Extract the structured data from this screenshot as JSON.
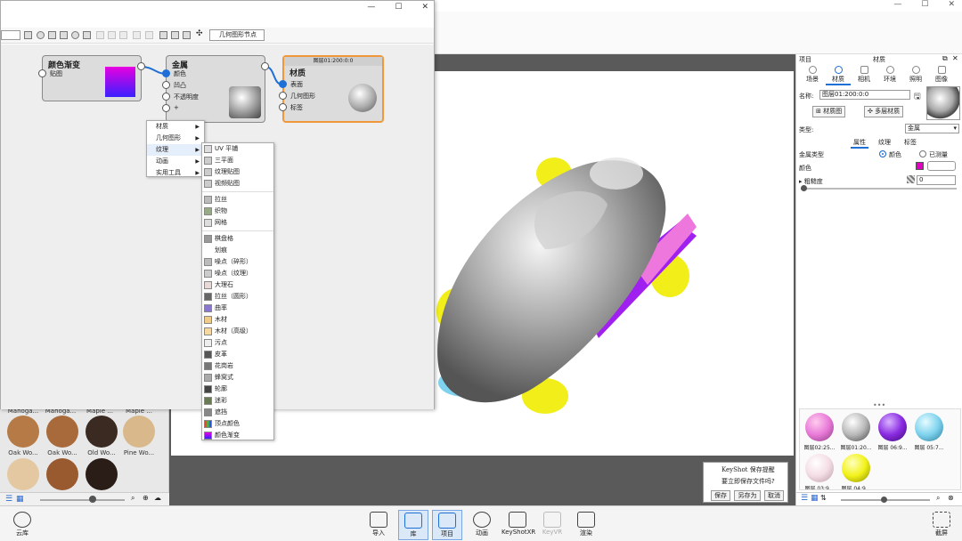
{
  "app": {
    "window_controls": [
      "—",
      "☐",
      "✕"
    ]
  },
  "graph_window": {
    "window_controls": [
      "—",
      "☐",
      "✕"
    ],
    "toolbar_search": "几何图形节点",
    "nodes": {
      "gradient": {
        "title": "颜色渐变",
        "port": "贴图"
      },
      "metal": {
        "title": "金属",
        "ports": [
          "颜色",
          "凹凸",
          "不透明度",
          "+"
        ]
      },
      "material": {
        "header": "图层01:200:0:0",
        "title": "材质",
        "ports": [
          "表面",
          "几何图形",
          "标签"
        ]
      }
    },
    "context_menu": [
      {
        "label": "材质"
      },
      {
        "label": "几何图形"
      },
      {
        "label": "纹理"
      },
      {
        "label": "动画"
      },
      {
        "label": "实用工具"
      }
    ],
    "texture_submenu": {
      "group1": [
        "UV 平铺",
        "三平面",
        "纹理贴图",
        "视频贴图"
      ],
      "group2": [
        "拉丝",
        "织物",
        "网格"
      ],
      "group3": [
        "棋盘格",
        "划痕",
        "噪点（碎形）",
        "噪点（纹理）",
        "大理石",
        "拉丝（圆形）",
        "曲率",
        "木材",
        "木材（高级）",
        "污点",
        "皮革",
        "花岗岩",
        "蜂窝式",
        "轮廓",
        "迷彩",
        "遮挡",
        "顶点颜色",
        "颜色渐变"
      ]
    }
  },
  "library": {
    "top_labels": [
      "Mahoga...",
      "Mahoga...",
      "Maple ...",
      "Maple ..."
    ],
    "items": [
      {
        "label": "Oak Wo...",
        "color": "#b57a45"
      },
      {
        "label": "Oak Wo...",
        "color": "#a86a3a"
      },
      {
        "label": "Old Wo...",
        "color": "#3a2a22"
      },
      {
        "label": "Pine Wo...",
        "color": "#d9b98c"
      },
      {
        "label": "",
        "color": "#e3c8a2"
      },
      {
        "label": "",
        "color": "#9a5a30"
      },
      {
        "label": "",
        "color": "#2a1c16"
      }
    ]
  },
  "right_panel": {
    "header_left": "项目",
    "header_center": "材质",
    "tabs": [
      "场景",
      "材质",
      "相机",
      "环境",
      "照明",
      "图像"
    ],
    "name_label": "名称:",
    "name_value": "图层01:200:0:0",
    "btn_graph": "材质图",
    "btn_multi": "多层材质",
    "type_label": "类型:",
    "type_value": "金属",
    "subtabs": [
      "属性",
      "纹理",
      "标签"
    ],
    "metal_type_label": "金属类型",
    "radio_color": "颜色",
    "radio_measured": "已测量",
    "color_label": "颜色",
    "roughness_label": "粗糙度",
    "roughness_value": "0",
    "swatch_color": "#e000c0",
    "dots": "•••",
    "balls": [
      {
        "label": "图层02:25...",
        "color": "#e87ad8"
      },
      {
        "label": "图层01:20...",
        "color": "#b8b8b8"
      },
      {
        "label": "图层 06:9...",
        "color": "#8a2be2"
      },
      {
        "label": "图层 05:7...",
        "color": "#7fd3ee"
      },
      {
        "label": "图层 03:9...",
        "color": "#f4dde4"
      },
      {
        "label": "图层 04:9...",
        "color": "#f2f21a"
      }
    ]
  },
  "save_dialog": {
    "title": "KeyShot 保存提醒",
    "message": "要立即保存文件吗?",
    "save": "保存",
    "save_as": "另存为",
    "cancel": "取消"
  },
  "bottom_bar": {
    "cloud": "云库",
    "items": [
      "导入",
      "库",
      "项目",
      "动画",
      "KeyShotXR",
      "KeyVR",
      "渲染"
    ],
    "screenshot": "截屏"
  }
}
